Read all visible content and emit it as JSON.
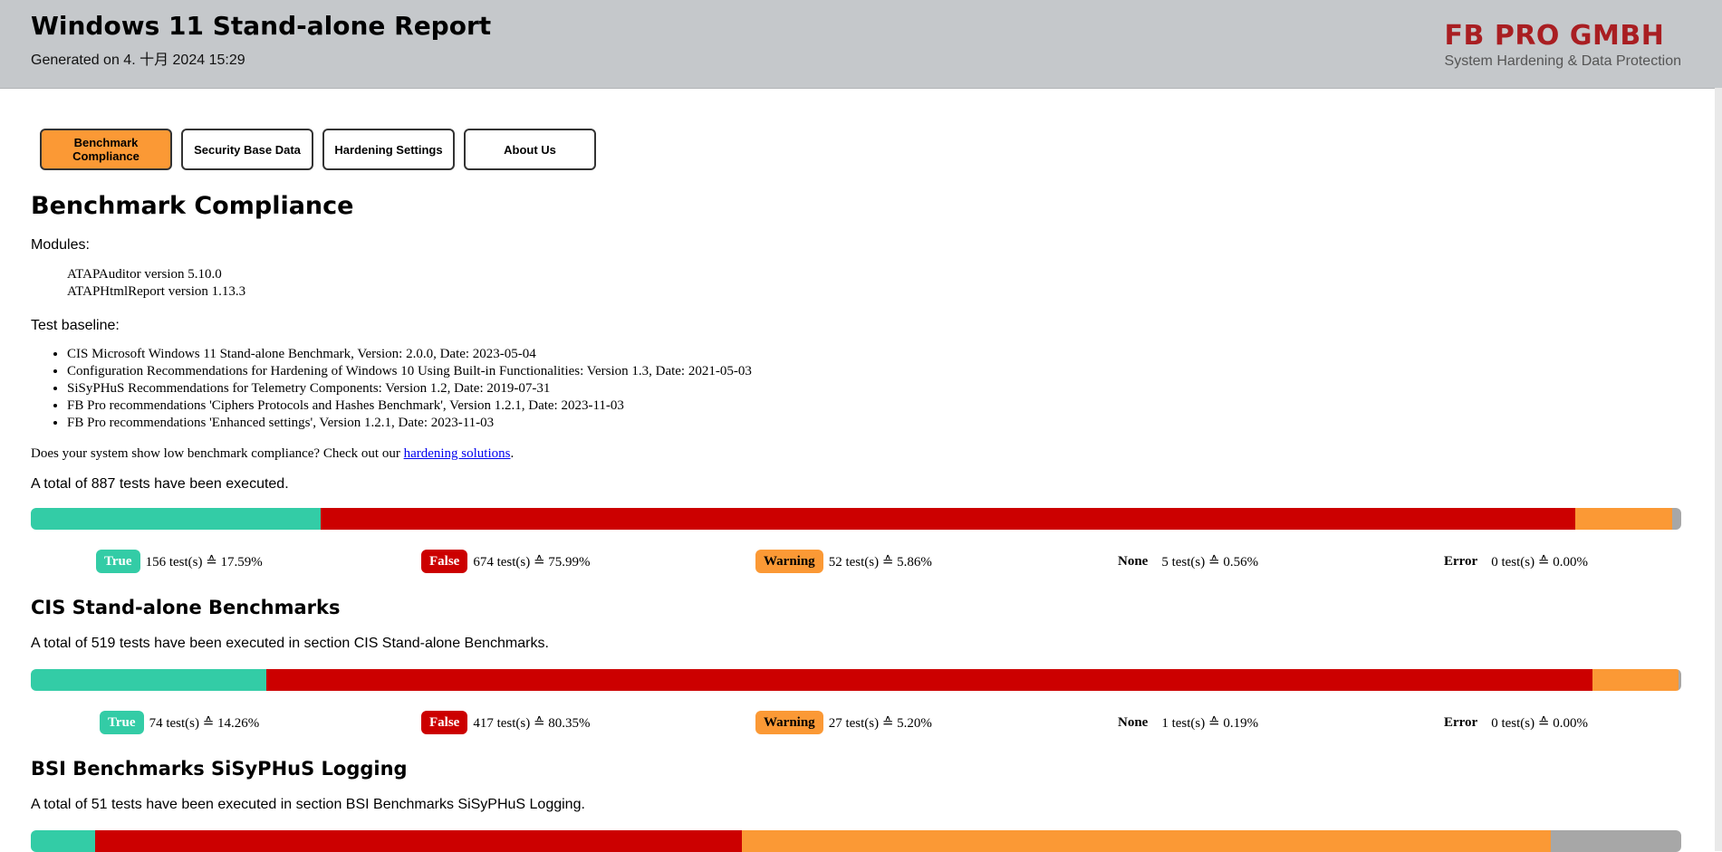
{
  "header": {
    "title": "Windows 11 Stand-alone Report",
    "generated": "Generated on 4. 十月 2024 15:29",
    "brand_name": "FB PRO GMBH",
    "brand_tagline": "System Hardening & Data Protection"
  },
  "tabs": [
    {
      "label": "Benchmark Compliance",
      "active": true
    },
    {
      "label": "Security Base Data",
      "active": false
    },
    {
      "label": "Hardening Settings",
      "active": false
    },
    {
      "label": "About Us",
      "active": false
    }
  ],
  "main": {
    "heading": "Benchmark Compliance",
    "modules_label": "Modules:",
    "modules": [
      "ATAPAuditor version 5.10.0",
      "ATAPHtmlReport version 1.13.3"
    ],
    "baseline_label": "Test baseline:",
    "baseline": [
      "CIS Microsoft Windows 11 Stand-alone Benchmark, Version: 2.0.0, Date: 2023-05-04",
      "Configuration Recommendations for Hardening of Windows 10 Using Built-in Functionalities: Version 1.3, Date: 2021-05-03",
      "SiSyPHuS Recommendations for Telemetry Components: Version 1.2, Date: 2019-07-31",
      "FB Pro recommendations 'Ciphers Protocols and Hashes Benchmark', Version 1.2.1, Date: 2023-11-03",
      "FB Pro recommendations 'Enhanced settings', Version 1.2.1, Date: 2023-11-03"
    ],
    "cta_text": "Does your system show low benchmark compliance? Check out our ",
    "cta_link": "hardening solutions",
    "cta_end": ".",
    "total_text": "A total of 887 tests have been executed.",
    "overall": {
      "fractions": {
        "true": 0.1759,
        "false": 0.7599,
        "warning": 0.0586,
        "none": 0.0056,
        "error": 0.0
      },
      "legend": [
        {
          "badge": "True",
          "text": "156 test(s) ≙ 17.59%"
        },
        {
          "badge": "False",
          "text": "674 test(s) ≙ 75.99%"
        },
        {
          "badge": "Warning",
          "text": "52 test(s) ≙ 5.86%"
        },
        {
          "badge": "None",
          "text": "5 test(s) ≙ 0.56%"
        },
        {
          "badge": "Error",
          "text": "0 test(s) ≙ 0.00%"
        }
      ]
    }
  },
  "sections": [
    {
      "title": "CIS Stand-alone Benchmarks",
      "total_text": "A total of 519 tests have been executed in section CIS Stand-alone Benchmarks.",
      "fractions": {
        "true": 0.1426,
        "false": 0.8035,
        "warning": 0.052,
        "none": 0.0019,
        "error": 0.0
      },
      "legend": [
        {
          "badge": "True",
          "text": "74 test(s) ≙ 14.26%"
        },
        {
          "badge": "False",
          "text": "417 test(s) ≙ 80.35%"
        },
        {
          "badge": "Warning",
          "text": "27 test(s) ≙ 5.20%"
        },
        {
          "badge": "None",
          "text": "1 test(s) ≙ 0.19%"
        },
        {
          "badge": "Error",
          "text": "0 test(s) ≙ 0.00%"
        }
      ]
    },
    {
      "title": "BSI Benchmarks SiSyPHuS Logging",
      "total_text": "A total of 51 tests have been executed in section BSI Benchmarks SiSyPHuS Logging.",
      "fractions": {
        "true": 0.039,
        "false": 0.392,
        "warning": 0.49,
        "none": 0.079,
        "error": 0.0
      }
    }
  ],
  "colors": {
    "true": "#33cca6",
    "false": "#cc0000",
    "warning": "#fb9935",
    "none": "#a7a7a7",
    "brand": "#a91e22"
  }
}
